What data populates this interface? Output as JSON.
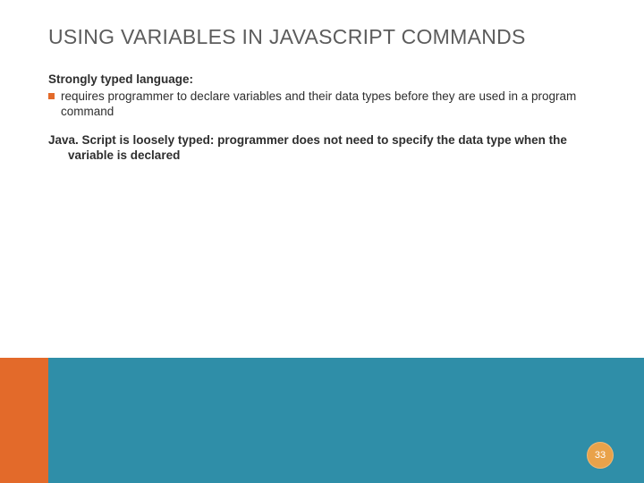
{
  "slide": {
    "title": "USING VARIABLES IN JAVASCRIPT COMMANDS",
    "subhead": "Strongly typed language:",
    "bullet": "requires programmer to declare variables and their  data types before they are used in a program command",
    "para": "Java. Script is loosely typed: programmer does not need to specify the data type when the variable is declared",
    "page_number": "33"
  },
  "colors": {
    "orange": "#e36a2a",
    "teal": "#2f8ea8",
    "badge": "#e9a24a"
  }
}
